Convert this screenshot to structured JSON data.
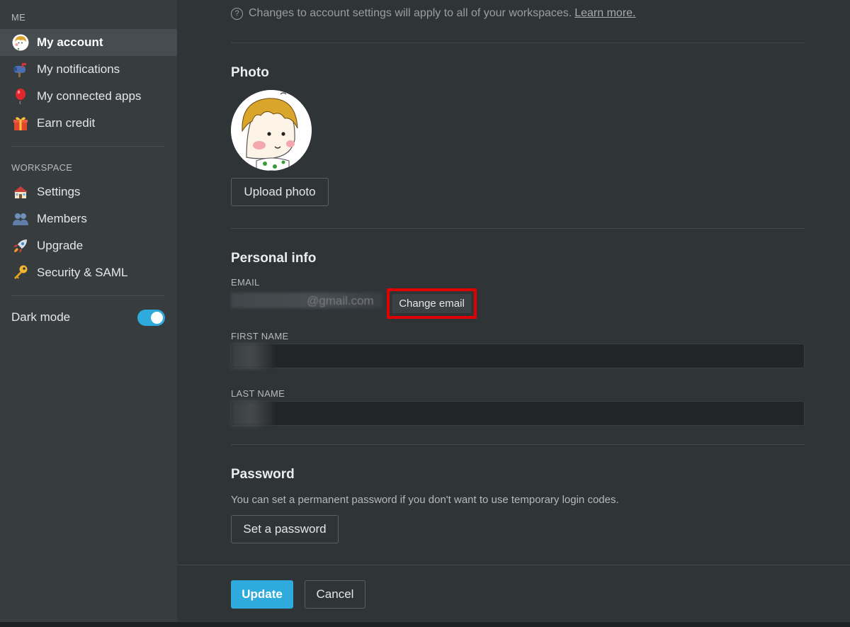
{
  "sidebar": {
    "me_label": "ME",
    "me_items": [
      {
        "label": "My account",
        "icon": "avatar-icon",
        "active": true
      },
      {
        "label": "My notifications",
        "icon": "mailbox-icon"
      },
      {
        "label": "My connected apps",
        "icon": "balloon-icon"
      },
      {
        "label": "Earn credit",
        "icon": "gift-icon"
      }
    ],
    "workspace_label": "WORKSPACE",
    "workspace_items": [
      {
        "label": "Settings",
        "icon": "house-icon"
      },
      {
        "label": "Members",
        "icon": "people-icon"
      },
      {
        "label": "Upgrade",
        "icon": "rocket-icon"
      },
      {
        "label": "Security & SAML",
        "icon": "key-icon"
      }
    ],
    "dark_mode_label": "Dark mode",
    "dark_mode_on": true
  },
  "main": {
    "hint_text": "Changes to account settings will apply to all of your workspaces.",
    "learn_more": "Learn more.",
    "photo_title": "Photo",
    "upload_photo": "Upload photo",
    "personal_title": "Personal info",
    "email_label": "EMAIL",
    "email_domain": "@gmail.com",
    "change_email": "Change email",
    "first_name_label": "FIRST NAME",
    "last_name_label": "LAST NAME",
    "password_title": "Password",
    "password_desc": "You can set a permanent password if you don't want to use temporary login codes.",
    "set_password": "Set a password",
    "update": "Update",
    "cancel": "Cancel"
  },
  "colors": {
    "accent": "#2eaadc",
    "highlight_box": "#e00000"
  }
}
